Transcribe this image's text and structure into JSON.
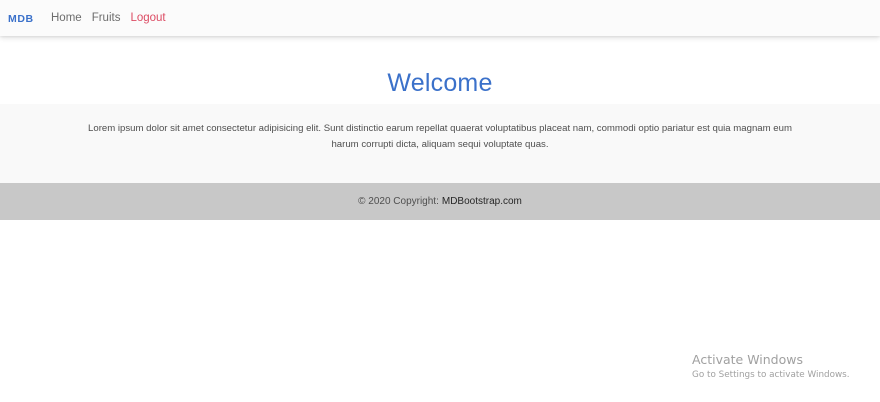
{
  "navbar": {
    "brand": "MDB",
    "links": [
      {
        "label": "Home"
      },
      {
        "label": "Fruits"
      },
      {
        "label": "Logout"
      }
    ]
  },
  "hero": {
    "title": "Welcome"
  },
  "content": {
    "paragraph": "Lorem ipsum dolor sit amet consectetur adipisicing elit. Sunt distinctio earum repellat quaerat voluptatibus placeat nam, commodi optio pariatur est quia magnam eum harum corrupti dicta, aliquam sequi voluptate quas."
  },
  "footer": {
    "copyright": "© 2020 Copyright:",
    "link_label": "MDBootstrap.com"
  },
  "watermark": {
    "title": "Activate Windows",
    "subtitle": "Go to Settings to activate Windows."
  },
  "colors": {
    "brand_blue": "#3b71ca",
    "logout_red": "#dc4c64",
    "footer_bg": "#c8c8c8",
    "content_bg": "#f9f9f9"
  }
}
